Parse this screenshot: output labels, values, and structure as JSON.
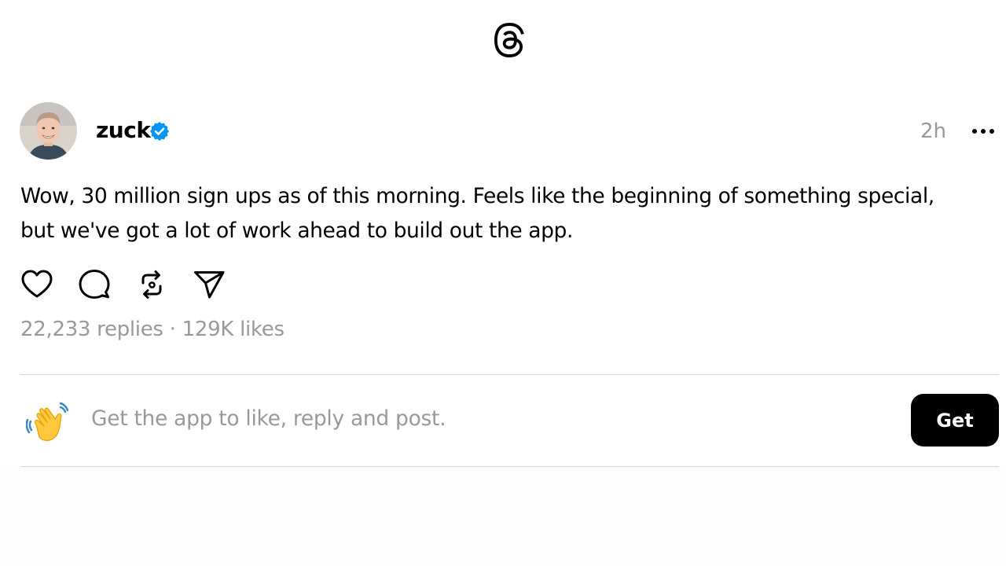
{
  "app": {
    "logo_icon": "threads-logo-icon"
  },
  "post": {
    "author": {
      "username": "zuck",
      "verified_icon": "verified-badge-icon",
      "avatar_icon": "avatar"
    },
    "timestamp": "2h",
    "more_icon": "more-options-icon",
    "text_line1": "Wow, 30 million sign ups as of this morning. Feels like the beginning of something special,",
    "text_line2": "but we've got a lot of work ahead to build out the app.",
    "actions": [
      {
        "name": "like",
        "icon": "heart-icon"
      },
      {
        "name": "reply",
        "icon": "comment-icon"
      },
      {
        "name": "repost",
        "icon": "repost-icon"
      },
      {
        "name": "share",
        "icon": "send-icon"
      }
    ],
    "stats": {
      "replies": "22,233 replies",
      "separator": "·",
      "likes": "129K likes"
    }
  },
  "cta": {
    "icon": "waving-hand-icon",
    "text": "Get the app to like, reply and post.",
    "button_label": "Get"
  },
  "colors": {
    "verified_blue": "#0095f6",
    "muted_text": "#999999",
    "button_bg": "#000000",
    "divider": "#d8d8d8"
  }
}
